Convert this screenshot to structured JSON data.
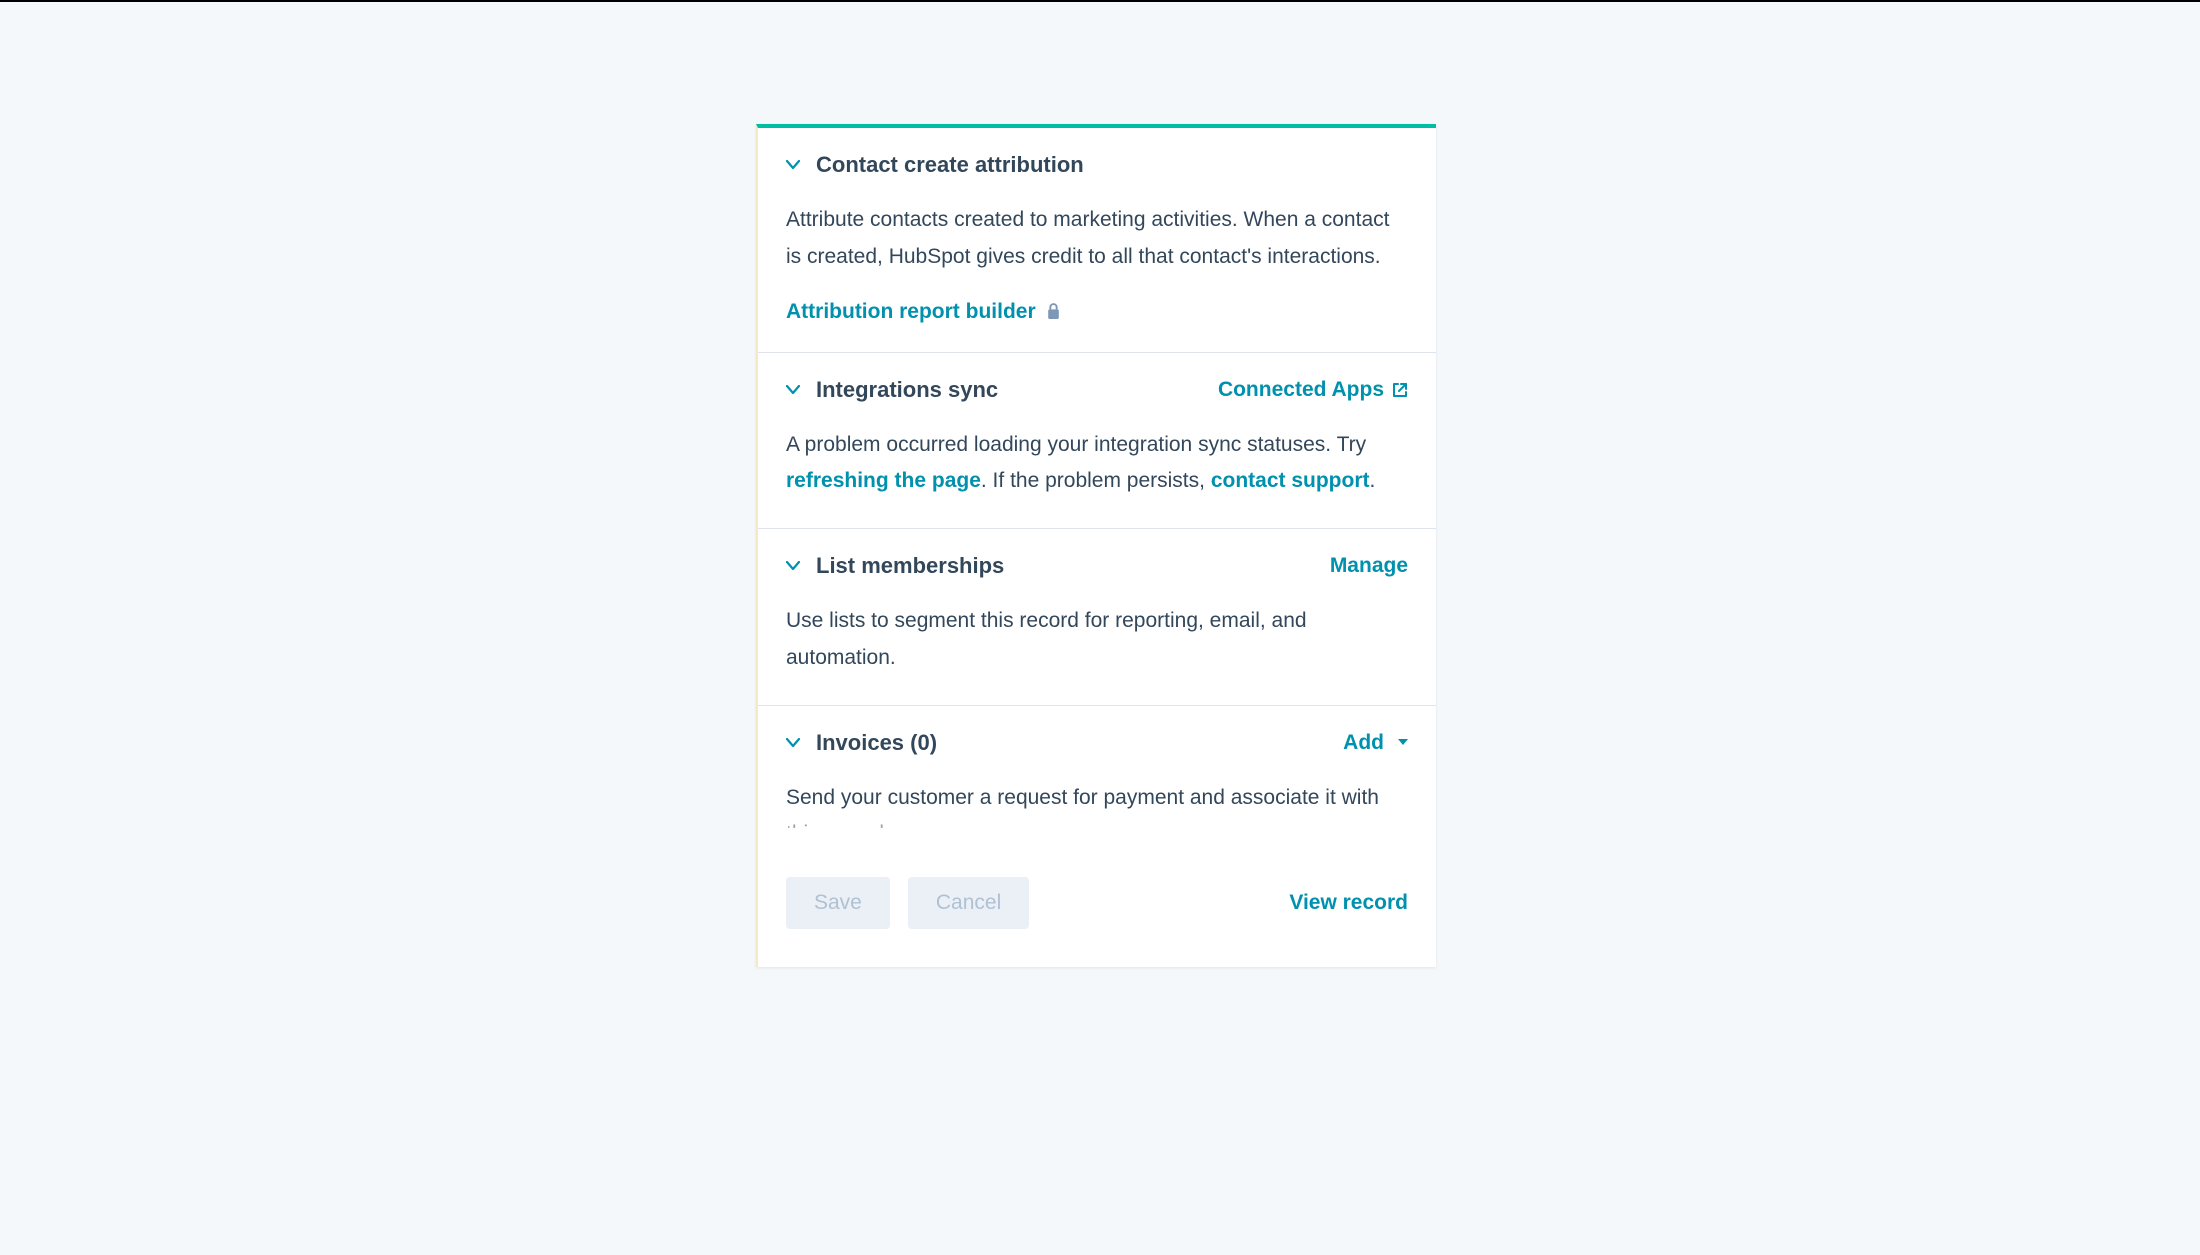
{
  "colors": {
    "accent": "#0091ae",
    "topBorder": "#00bda5",
    "text": "#33475b"
  },
  "sections": {
    "attribution": {
      "title": "Contact create attribution",
      "body": "Attribute contacts created to marketing activities. When a contact is created, HubSpot gives credit to all that contact's interactions.",
      "link_label": "Attribution report builder"
    },
    "integrations": {
      "title": "Integrations sync",
      "action_label": "Connected Apps",
      "body_prefix": "A problem occurred loading your integration sync statuses. Try ",
      "refresh_link": "refreshing the page",
      "body_mid": ". If the problem persists, ",
      "support_link": "contact support",
      "body_suffix": "."
    },
    "lists": {
      "title": "List memberships",
      "action_label": "Manage",
      "body": "Use lists to segment this record for reporting, email, and automation."
    },
    "invoices": {
      "title": "Invoices (0)",
      "action_label": "Add",
      "body": "Send your customer a request for payment and associate it with this record."
    }
  },
  "footer": {
    "save_label": "Save",
    "cancel_label": "Cancel",
    "view_record_label": "View record"
  }
}
